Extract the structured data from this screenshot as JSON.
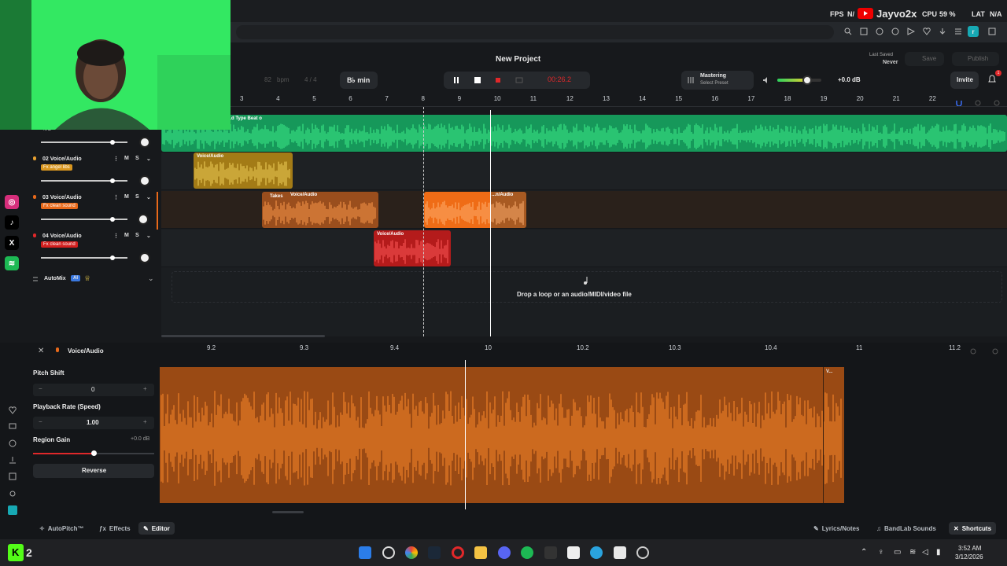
{
  "browser": {
    "fps_label": "FPS",
    "fps_value": "N/",
    "streamer": "Jayvo2x",
    "cpu_label": "CPU",
    "cpu_value": "59 %",
    "lat_label": "LAT",
    "lat_value": "N/A",
    "profile_initial": "r"
  },
  "header": {
    "project_title": "New Project",
    "last_saved_label": "Last Saved",
    "last_saved_value": "Never",
    "save_label": "Save",
    "publish_label": "Publish",
    "invite_label": "Invite",
    "notif_count": "1"
  },
  "transport": {
    "bpm_value": "82",
    "bpm_unit": "bpm",
    "time_signature": "4 / 4",
    "key": "B♭ min",
    "time": "00:26.2",
    "mastering_label": "Mastering",
    "mastering_preset": "Select Preset",
    "master_volume": "+0.0 dB",
    "master_level_fraction": 0.68
  },
  "ruler": {
    "bars": [
      "3",
      "4",
      "5",
      "6",
      "7",
      "8",
      "9",
      "10",
      "11",
      "12",
      "13",
      "14",
      "15",
      "16",
      "17",
      "18",
      "19",
      "20",
      "21",
      "22"
    ]
  },
  "tracks": [
    {
      "id": "01",
      "name": "",
      "fx": "+Fx",
      "fader": 0.83,
      "region_label": "...d Type Beat o",
      "color": "#1fbf6a"
    },
    {
      "id": "02",
      "name": "02  Voice/Audio",
      "fx": "Fx  angel libs",
      "fader": 0.83,
      "region_label": "Voice/Audio",
      "color": "#c9971e"
    },
    {
      "id": "03",
      "name": "03  Voice/Audio",
      "fx": "Fx  clean sound",
      "fader": 0.83,
      "region_label": "Voice/Audio",
      "takes_label": "Takes",
      "region2_label": "...n/Audio",
      "color": "#e8691a"
    },
    {
      "id": "04",
      "name": "04  Voice/Audio",
      "fx": "Fx  clean sound",
      "fader": 0.83,
      "region_label": "Voice/Audio",
      "color": "#d21f1f"
    }
  ],
  "track_buttons": {
    "mute": "M",
    "solo": "S"
  },
  "automix": {
    "label": "AutoMix",
    "badge": "AI"
  },
  "drop_zone": {
    "text": "Drop a loop or an audio/MIDI/video file"
  },
  "editor": {
    "track_label": "Voice/Audio",
    "ruler": [
      "9.2",
      "9.3",
      "9.4",
      "10",
      "10.2",
      "10.3",
      "10.4",
      "11",
      "11.2"
    ],
    "region_tag": "V...",
    "pitch_shift_label": "Pitch Shift",
    "pitch_shift_value": "0",
    "playback_rate_label": "Playback Rate (Speed)",
    "playback_rate_value": "1.00",
    "region_gain_label": "Region Gain",
    "region_gain_value": "+0.0 dB",
    "region_gain_fraction": 0.5,
    "reverse_label": "Reverse"
  },
  "bottom_tabs": {
    "autopitch": "AutoPitch™",
    "effects": "Effects",
    "editor": "Editor",
    "lyrics": "Lyrics/Notes",
    "sounds": "BandLab Sounds",
    "shortcuts": "Shortcuts"
  },
  "taskbar": {
    "app_badge": "2",
    "clock_time": "3:52 AM",
    "clock_date": "3/12/2026"
  },
  "colors": {
    "accent_orange": "#e8691a",
    "record_red": "#e0282a",
    "beat_green": "#1fbf6a",
    "invite_bg": "#2a2d31"
  }
}
